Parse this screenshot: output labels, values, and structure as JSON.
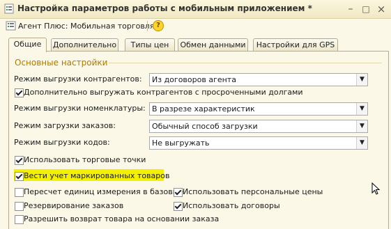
{
  "window": {
    "title": "Настройка параметров работы с мобильным приложением *",
    "app_icon": "settings-form-icon",
    "controls": {
      "minimize": "–",
      "maximize": "□",
      "close": "×"
    }
  },
  "toolbar": {
    "menu_label": "Агент Плюс: Мобильная торговля",
    "menu_arrow": "▾",
    "help_label": "?"
  },
  "tabs": [
    {
      "label": "Общие",
      "active": true
    },
    {
      "label": "Дополнительно",
      "active": false
    },
    {
      "label": "Типы цен",
      "active": false
    },
    {
      "label": "Обмен данными",
      "active": false
    },
    {
      "label": "Настройки для GPS",
      "active": false
    }
  ],
  "main": {
    "section_title": "Основные настройки",
    "fields": {
      "contractors_mode": {
        "label": "Режим выгрузки контрагентов:",
        "value": "Из договоров агента"
      },
      "nomenclature_mode": {
        "label": "Режим выгрузки номенклатуры:",
        "value": "В разрезе характеристик"
      },
      "orders_mode": {
        "label": "Режим загрузки заказов:",
        "value": "Обычный способ загрузки"
      },
      "codes_mode": {
        "label": "Режим выгрузки кодов:",
        "value": "Не выгружать"
      }
    },
    "checkboxes": {
      "overdue_debts": {
        "label": "Дополнительно выгружать контрагентов с просроченными долгами",
        "checked": true
      },
      "trade_points": {
        "label": "Использовать торговые точки",
        "checked": true
      },
      "marked_goods": {
        "label": "Вести учет маркированных товаров",
        "checked": true
      },
      "recalc_units": {
        "label": "Пересчет единиц измерения в базовые",
        "checked": false
      },
      "personal_prices": {
        "label": "Использовать персональные цены",
        "checked": true
      },
      "reserve_orders": {
        "label": "Резервирование заказов",
        "checked": false
      },
      "use_contracts": {
        "label": "Использовать договоры",
        "checked": true
      },
      "allow_return": {
        "label": "Разрешить возврат товара на основании заказа",
        "checked": false
      }
    }
  },
  "colors": {
    "highlight": "#f3f000",
    "section_title": "#b07a00",
    "window_bg": "#fbf8e8"
  }
}
